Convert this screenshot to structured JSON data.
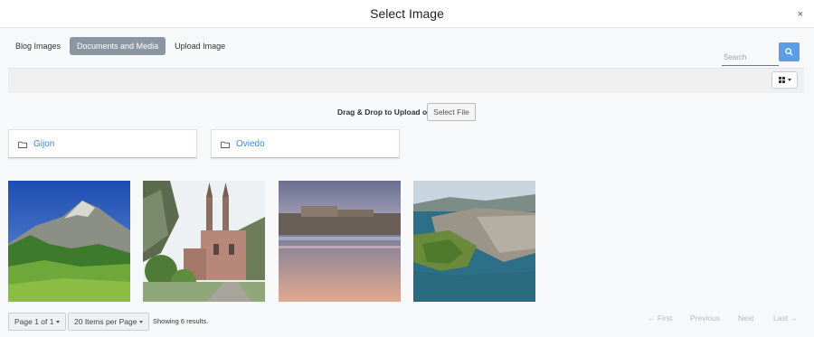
{
  "dialog": {
    "title": "Select Image",
    "close_label": "×"
  },
  "tabs": [
    {
      "label": "Blog Images",
      "active": false
    },
    {
      "label": "Documents and Media",
      "active": true
    },
    {
      "label": "Upload Image",
      "active": false
    }
  ],
  "search": {
    "placeholder": "Search",
    "icon": "search-icon"
  },
  "view": {
    "icon": "grid-icon"
  },
  "upload": {
    "drag_text": "Drag & Drop to Upload or",
    "select_file_label": "Select File"
  },
  "folders": [
    {
      "name": "Gijon",
      "icon": "folder-icon"
    },
    {
      "name": "Oviedo",
      "icon": "folder-icon"
    }
  ],
  "thumbnails": [
    {
      "subject": "mountain meadow"
    },
    {
      "subject": "basilica"
    },
    {
      "subject": "beach at dusk"
    },
    {
      "subject": "coastal city aerial"
    }
  ],
  "pagination": {
    "page_label": "Page 1 of 1",
    "items_per_page_label": "20 Items per Page",
    "results_text": "Showing 6 results.",
    "first": "← First",
    "previous": "Previous",
    "next": "Next",
    "last": "Last →"
  },
  "colors": {
    "accent": "#5b9ee8",
    "active_tab": "#8b96a3",
    "folder_link": "#3a8ad6"
  }
}
